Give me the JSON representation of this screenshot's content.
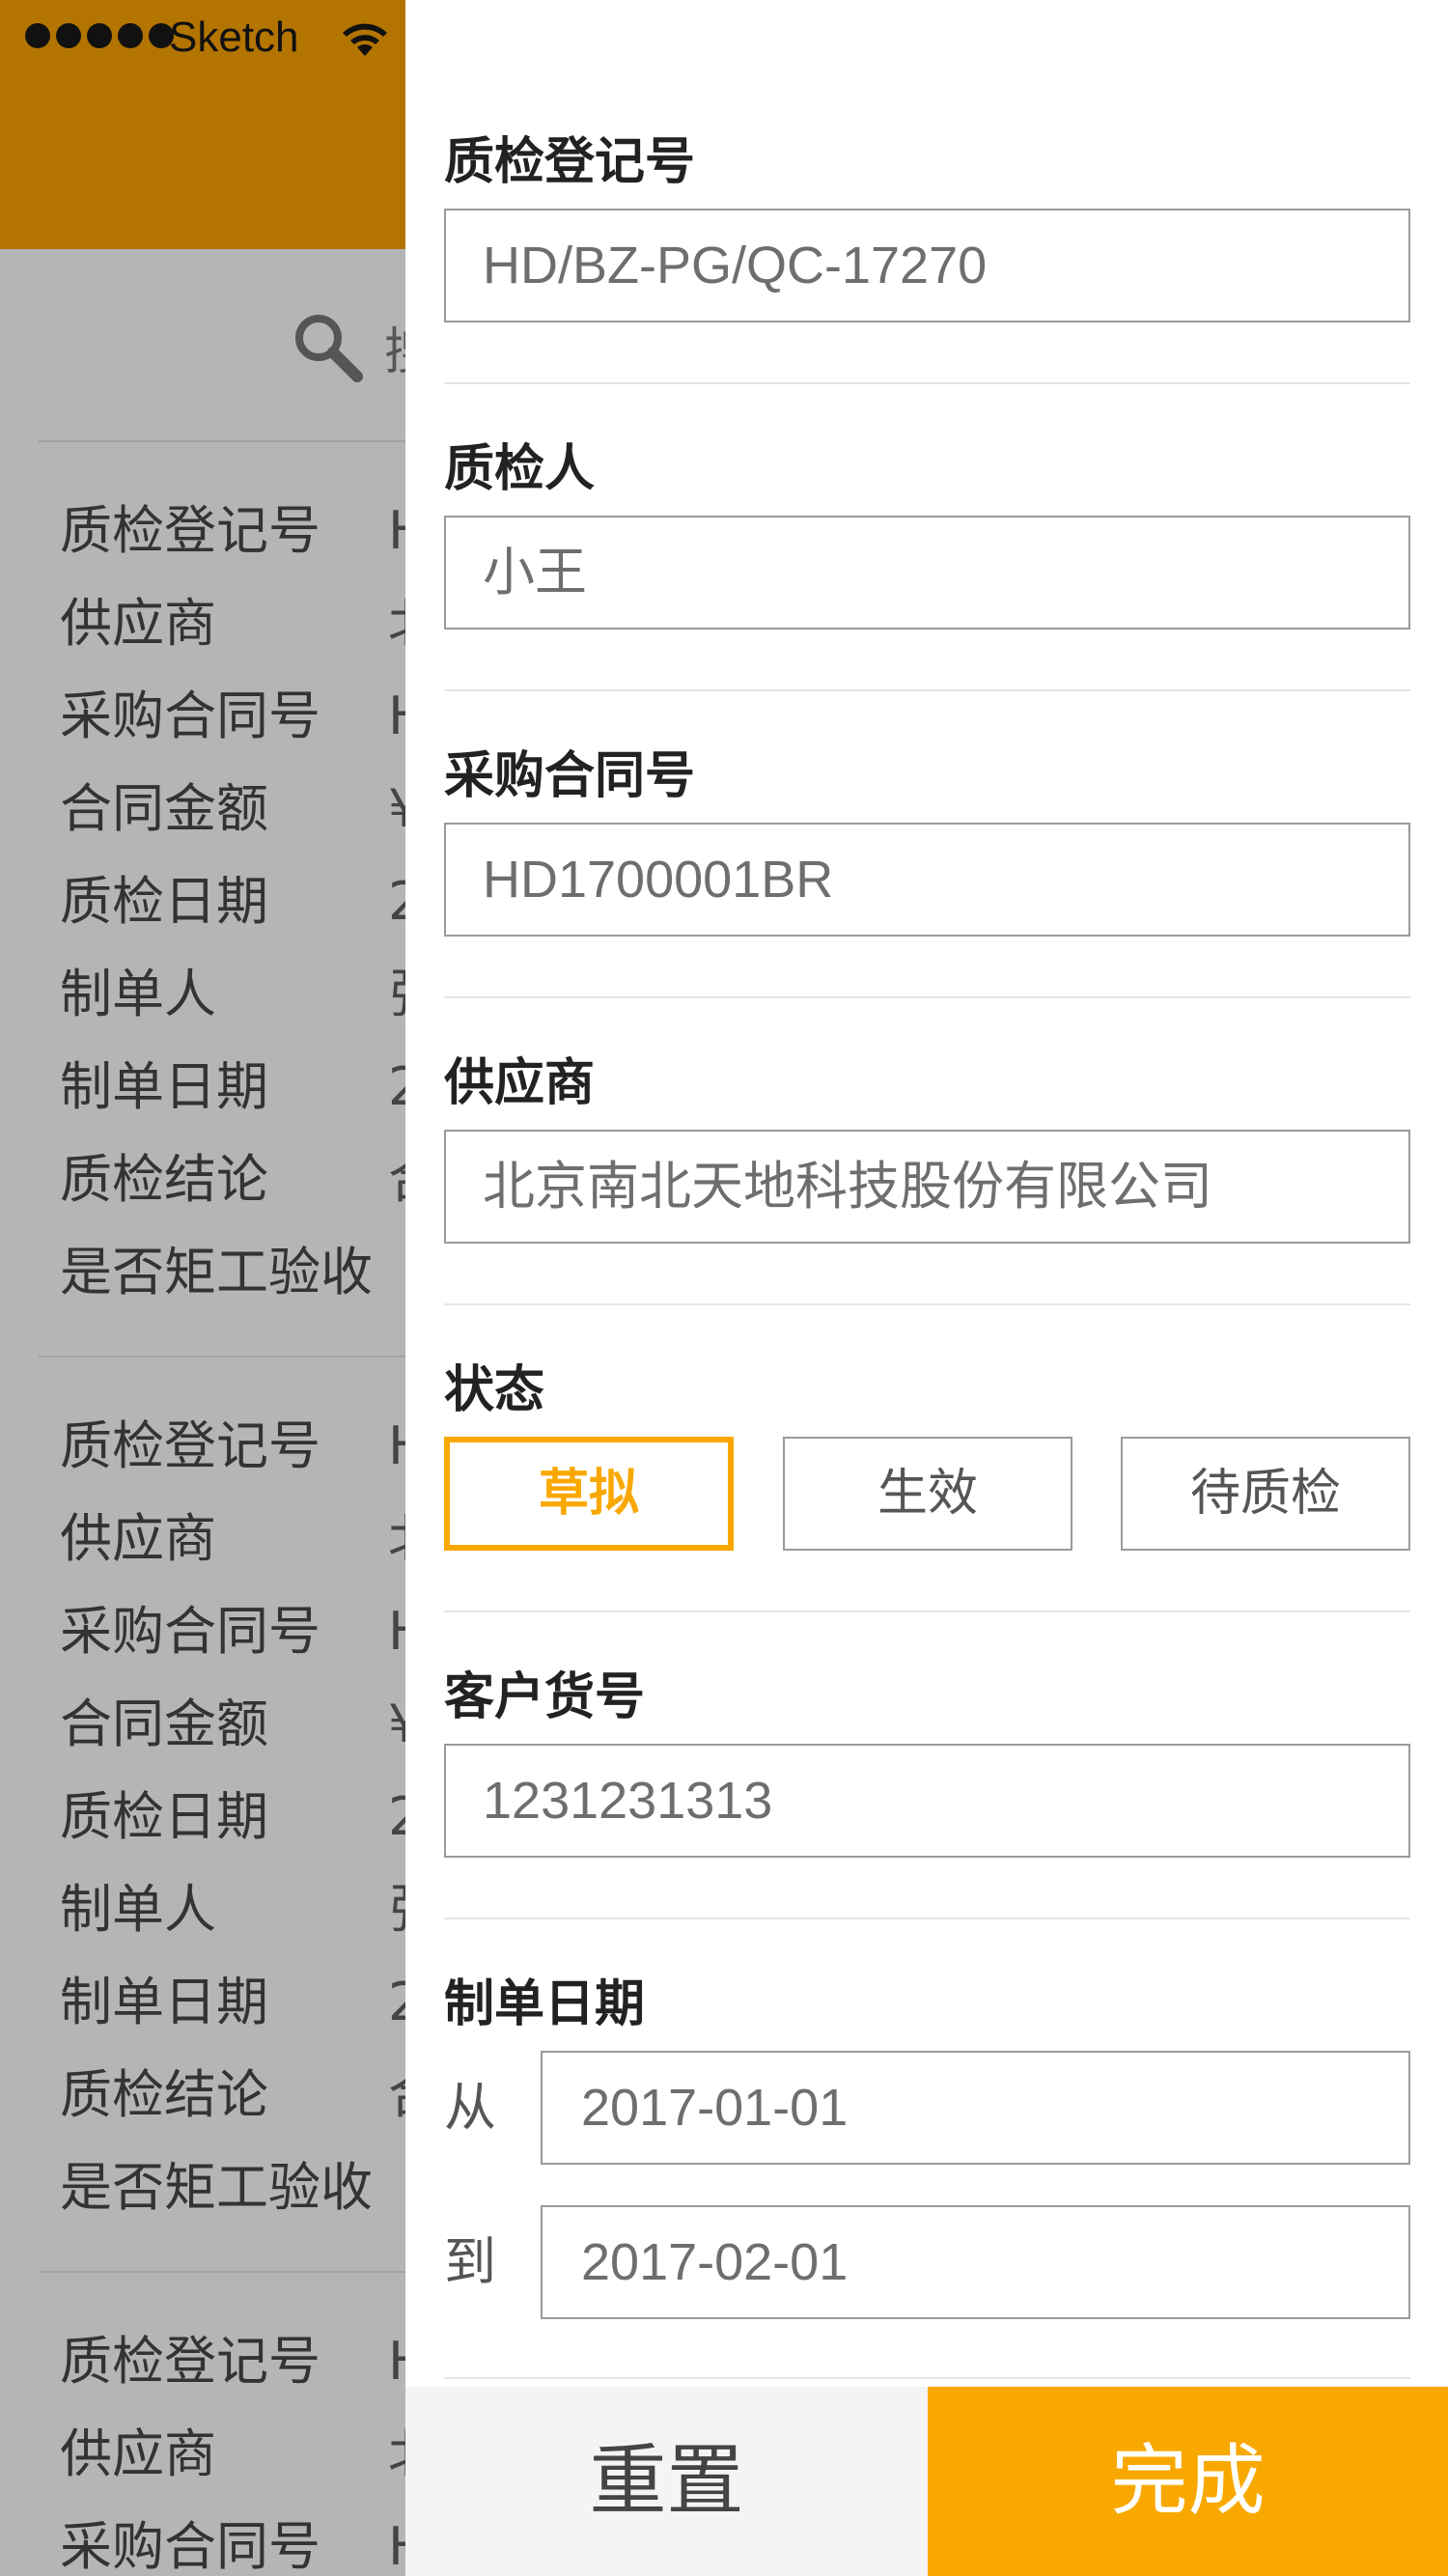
{
  "status_bar": {
    "carrier": "Sketch",
    "signal_dots": 5,
    "wifi_icon": "wifi-icon"
  },
  "background_list": {
    "search_icon": "search-icon",
    "search_placeholder_fragment": "搜",
    "records": [
      {
        "rows": [
          {
            "label": "质检登记号",
            "value_fragment": "H"
          },
          {
            "label": "供应商",
            "value_fragment": "北"
          },
          {
            "label": "采购合同号",
            "value_fragment": "H"
          },
          {
            "label": "合同金额",
            "value_fragment": "¥"
          },
          {
            "label": "质检日期",
            "value_fragment": "2"
          },
          {
            "label": "制单人",
            "value_fragment": "张"
          },
          {
            "label": "制单日期",
            "value_fragment": "2"
          },
          {
            "label": "质检结论",
            "value_fragment": "合"
          },
          {
            "label": "是否矩工验收",
            "value_fragment": ""
          }
        ]
      },
      {
        "rows": [
          {
            "label": "质检登记号",
            "value_fragment": "H"
          },
          {
            "label": "供应商",
            "value_fragment": "北"
          },
          {
            "label": "采购合同号",
            "value_fragment": "H"
          },
          {
            "label": "合同金额",
            "value_fragment": "¥"
          },
          {
            "label": "质检日期",
            "value_fragment": "2"
          },
          {
            "label": "制单人",
            "value_fragment": "张"
          },
          {
            "label": "制单日期",
            "value_fragment": "2"
          },
          {
            "label": "质检结论",
            "value_fragment": "合"
          },
          {
            "label": "是否矩工验收",
            "value_fragment": ""
          }
        ]
      },
      {
        "rows": [
          {
            "label": "质检登记号",
            "value_fragment": "H"
          },
          {
            "label": "供应商",
            "value_fragment": "北"
          },
          {
            "label": "采购合同号",
            "value_fragment": "H"
          }
        ]
      }
    ]
  },
  "filter": {
    "qc_number": {
      "label": "质检登记号",
      "value": "HD/BZ-PG/QC-17270"
    },
    "inspector": {
      "label": "质检人",
      "value": "小王"
    },
    "contract_number": {
      "label": "采购合同号",
      "value": "HD1700001BR"
    },
    "supplier": {
      "label": "供应商",
      "value": "北京南北天地科技股份有限公司"
    },
    "status": {
      "label": "状态",
      "options": [
        "草拟",
        "生效",
        "待质检"
      ],
      "selected": "草拟"
    },
    "customer_item_number": {
      "label": "客户货号",
      "value": "1231231313"
    },
    "created_date": {
      "label": "制单日期",
      "from_label": "从",
      "from_value": "2017-01-01",
      "to_label": "到",
      "to_value": "2017-02-01"
    },
    "reset_label": "重置",
    "done_label": "完成"
  },
  "colors": {
    "accent": "#f9a800",
    "header_dimmed": "#b37400",
    "overlay": "#b5b5b5"
  }
}
